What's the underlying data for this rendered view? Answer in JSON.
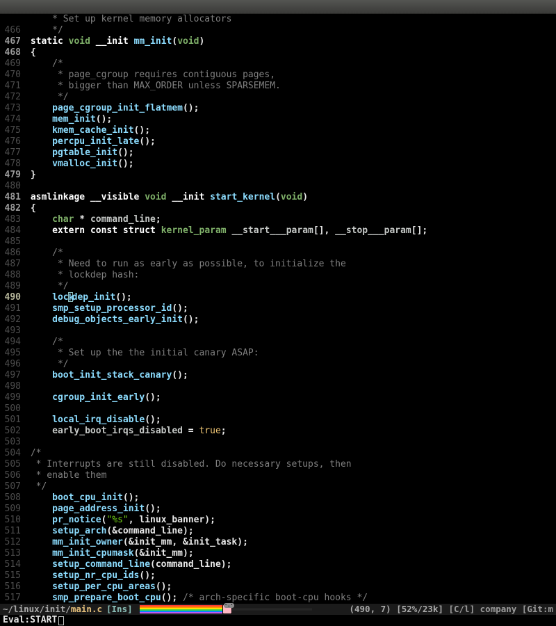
{
  "titlebar": {},
  "modeline": {
    "path_prefix": "~/linux/init/",
    "filename": "main.c",
    "mode_ins": "[Ins]",
    "position": "(490, 7)",
    "percent": "[52%/23k]",
    "modes": "[C/l] company [Git:m"
  },
  "minibuffer": {
    "prompt": "Eval: ",
    "input": "START"
  },
  "cursor": {
    "line": 490,
    "col": 7
  },
  "lines": [
    {
      "n": "   ",
      "bold": false,
      "segs": [
        [
          "    ",
          ""
        ],
        [
          " * Set up kernel memory allocators",
          "cmt"
        ]
      ]
    },
    {
      "n": 466,
      "bold": false,
      "segs": [
        [
          "    ",
          ""
        ],
        [
          " */",
          "cmt"
        ]
      ]
    },
    {
      "n": 467,
      "bold": true,
      "segs": [
        [
          " ",
          ""
        ],
        [
          "static",
          "kw"
        ],
        [
          " ",
          ""
        ],
        [
          "void",
          "typ"
        ],
        [
          " ",
          ""
        ],
        [
          "__init ",
          "kw"
        ],
        [
          "mm_init",
          "fn"
        ],
        [
          "(",
          "plain"
        ],
        [
          "void",
          "typ"
        ],
        [
          ")",
          "plain"
        ]
      ]
    },
    {
      "n": 468,
      "bold": true,
      "segs": [
        [
          " ",
          ""
        ],
        [
          "{",
          "plain"
        ]
      ]
    },
    {
      "n": 469,
      "bold": false,
      "segs": [
        [
          "     ",
          ""
        ],
        [
          "/*",
          "cmt"
        ]
      ]
    },
    {
      "n": 470,
      "bold": false,
      "segs": [
        [
          "     ",
          ""
        ],
        [
          " * page_cgroup requires contiguous pages,",
          "cmt"
        ]
      ]
    },
    {
      "n": 471,
      "bold": false,
      "segs": [
        [
          "     ",
          ""
        ],
        [
          " * bigger than MAX_ORDER unless SPARSEMEM.",
          "cmt"
        ]
      ]
    },
    {
      "n": 472,
      "bold": false,
      "segs": [
        [
          "     ",
          ""
        ],
        [
          " */",
          "cmt"
        ]
      ]
    },
    {
      "n": 473,
      "bold": false,
      "segs": [
        [
          "     ",
          ""
        ],
        [
          "page_cgroup_init_flatmem",
          "fn"
        ],
        [
          "();",
          "plain"
        ]
      ]
    },
    {
      "n": 474,
      "bold": false,
      "segs": [
        [
          "     ",
          ""
        ],
        [
          "mem_init",
          "fn"
        ],
        [
          "();",
          "plain"
        ]
      ]
    },
    {
      "n": 475,
      "bold": false,
      "segs": [
        [
          "     ",
          ""
        ],
        [
          "kmem_cache_init",
          "fn"
        ],
        [
          "();",
          "plain"
        ]
      ]
    },
    {
      "n": 476,
      "bold": false,
      "segs": [
        [
          "     ",
          ""
        ],
        [
          "percpu_init_late",
          "fn"
        ],
        [
          "();",
          "plain"
        ]
      ]
    },
    {
      "n": 477,
      "bold": false,
      "segs": [
        [
          "     ",
          ""
        ],
        [
          "pgtable_init",
          "fn"
        ],
        [
          "();",
          "plain"
        ]
      ]
    },
    {
      "n": 478,
      "bold": false,
      "segs": [
        [
          "     ",
          ""
        ],
        [
          "vmalloc_init",
          "fn"
        ],
        [
          "();",
          "plain"
        ]
      ]
    },
    {
      "n": 479,
      "bold": true,
      "segs": [
        [
          " ",
          ""
        ],
        [
          "}",
          "plain"
        ]
      ]
    },
    {
      "n": 480,
      "bold": false,
      "segs": [
        [
          "",
          ""
        ]
      ]
    },
    {
      "n": 481,
      "bold": true,
      "segs": [
        [
          " ",
          ""
        ],
        [
          "asmlinkage ",
          "kw"
        ],
        [
          "__visible ",
          "kw"
        ],
        [
          "void",
          "typ"
        ],
        [
          " ",
          ""
        ],
        [
          "__init ",
          "kw"
        ],
        [
          "start_kernel",
          "fn"
        ],
        [
          "(",
          "plain"
        ],
        [
          "void",
          "typ"
        ],
        [
          ")",
          "plain"
        ]
      ]
    },
    {
      "n": 482,
      "bold": true,
      "segs": [
        [
          " ",
          ""
        ],
        [
          "{",
          "plain"
        ]
      ]
    },
    {
      "n": 483,
      "bold": false,
      "segs": [
        [
          "     ",
          ""
        ],
        [
          "char",
          "typ"
        ],
        [
          " * ",
          "plain"
        ],
        [
          "command_line",
          "id"
        ],
        [
          ";",
          "plain"
        ]
      ]
    },
    {
      "n": 484,
      "bold": false,
      "segs": [
        [
          "     ",
          ""
        ],
        [
          "extern",
          "kw"
        ],
        [
          " ",
          ""
        ],
        [
          "const",
          "kw"
        ],
        [
          " ",
          ""
        ],
        [
          "struct",
          "kw"
        ],
        [
          " ",
          ""
        ],
        [
          "kernel_param",
          "typ"
        ],
        [
          " ",
          ""
        ],
        [
          "__start___param",
          "id"
        ],
        [
          "[], ",
          "plain"
        ],
        [
          "__stop___param",
          "id"
        ],
        [
          "[];",
          "plain"
        ]
      ]
    },
    {
      "n": 485,
      "bold": false,
      "segs": [
        [
          "",
          ""
        ]
      ]
    },
    {
      "n": 486,
      "bold": false,
      "segs": [
        [
          "     ",
          ""
        ],
        [
          "/*",
          "cmt"
        ]
      ]
    },
    {
      "n": 487,
      "bold": false,
      "segs": [
        [
          "     ",
          ""
        ],
        [
          " * Need to run as early as possible, to initialize the",
          "cmt"
        ]
      ]
    },
    {
      "n": 488,
      "bold": false,
      "segs": [
        [
          "     ",
          ""
        ],
        [
          " * lockdep hash:",
          "cmt"
        ]
      ]
    },
    {
      "n": 489,
      "bold": false,
      "segs": [
        [
          "     ",
          ""
        ],
        [
          " */",
          "cmt"
        ]
      ]
    },
    {
      "n": 490,
      "bold": false,
      "cursor": true,
      "segs": [
        [
          "     ",
          ""
        ],
        [
          "loc",
          "fn"
        ],
        [
          "CURSOR",
          ""
        ],
        [
          "dep_init",
          "fn"
        ],
        [
          "();",
          "plain"
        ]
      ]
    },
    {
      "n": 491,
      "bold": false,
      "segs": [
        [
          "     ",
          ""
        ],
        [
          "smp_setup_processor_id",
          "fn"
        ],
        [
          "();",
          "plain"
        ]
      ]
    },
    {
      "n": 492,
      "bold": false,
      "segs": [
        [
          "     ",
          ""
        ],
        [
          "debug_objects_early_init",
          "fn"
        ],
        [
          "();",
          "plain"
        ]
      ]
    },
    {
      "n": 493,
      "bold": false,
      "segs": [
        [
          "",
          ""
        ]
      ]
    },
    {
      "n": 494,
      "bold": false,
      "segs": [
        [
          "     ",
          ""
        ],
        [
          "/*",
          "cmt"
        ]
      ]
    },
    {
      "n": 495,
      "bold": false,
      "segs": [
        [
          "     ",
          ""
        ],
        [
          " * Set up the the initial canary ASAP:",
          "cmt"
        ]
      ]
    },
    {
      "n": 496,
      "bold": false,
      "segs": [
        [
          "     ",
          ""
        ],
        [
          " */",
          "cmt"
        ]
      ]
    },
    {
      "n": 497,
      "bold": false,
      "segs": [
        [
          "     ",
          ""
        ],
        [
          "boot_init_stack_canary",
          "fn"
        ],
        [
          "();",
          "plain"
        ]
      ]
    },
    {
      "n": 498,
      "bold": false,
      "segs": [
        [
          "",
          ""
        ]
      ]
    },
    {
      "n": 499,
      "bold": false,
      "segs": [
        [
          "     ",
          ""
        ],
        [
          "cgroup_init_early",
          "fn"
        ],
        [
          "();",
          "plain"
        ]
      ]
    },
    {
      "n": 500,
      "bold": false,
      "segs": [
        [
          "",
          ""
        ]
      ]
    },
    {
      "n": 501,
      "bold": false,
      "segs": [
        [
          "     ",
          ""
        ],
        [
          "local_irq_disable",
          "fn"
        ],
        [
          "();",
          "plain"
        ]
      ]
    },
    {
      "n": 502,
      "bold": false,
      "segs": [
        [
          "     ",
          ""
        ],
        [
          "early_boot_irqs_disabled",
          "id"
        ],
        [
          " = ",
          "plain"
        ],
        [
          "true",
          "cst"
        ],
        [
          ";",
          "plain"
        ]
      ]
    },
    {
      "n": 503,
      "bold": false,
      "segs": [
        [
          "",
          ""
        ]
      ]
    },
    {
      "n": 504,
      "bold": false,
      "segs": [
        [
          " ",
          ""
        ],
        [
          "/*",
          "cmt"
        ]
      ]
    },
    {
      "n": 505,
      "bold": false,
      "segs": [
        [
          " ",
          ""
        ],
        [
          " * Interrupts are still disabled. Do necessary setups, then",
          "cmt"
        ]
      ]
    },
    {
      "n": 506,
      "bold": false,
      "segs": [
        [
          " ",
          ""
        ],
        [
          " * enable them",
          "cmt"
        ]
      ]
    },
    {
      "n": 507,
      "bold": false,
      "segs": [
        [
          " ",
          ""
        ],
        [
          " */",
          "cmt"
        ]
      ]
    },
    {
      "n": 508,
      "bold": false,
      "segs": [
        [
          "     ",
          ""
        ],
        [
          "boot_cpu_init",
          "fn"
        ],
        [
          "();",
          "plain"
        ]
      ]
    },
    {
      "n": 509,
      "bold": false,
      "segs": [
        [
          "     ",
          ""
        ],
        [
          "page_address_init",
          "fn"
        ],
        [
          "();",
          "plain"
        ]
      ]
    },
    {
      "n": 510,
      "bold": false,
      "segs": [
        [
          "     ",
          ""
        ],
        [
          "pr_notice",
          "fn"
        ],
        [
          "(",
          "plain"
        ],
        [
          "\"%s\"",
          "str"
        ],
        [
          ", linux_banner);",
          "plain"
        ]
      ]
    },
    {
      "n": 511,
      "bold": false,
      "segs": [
        [
          "     ",
          ""
        ],
        [
          "setup_arch",
          "fn"
        ],
        [
          "(&command_line);",
          "plain"
        ]
      ]
    },
    {
      "n": 512,
      "bold": false,
      "segs": [
        [
          "     ",
          ""
        ],
        [
          "mm_init_owner",
          "fn"
        ],
        [
          "(&init_mm, &init_task);",
          "plain"
        ]
      ]
    },
    {
      "n": 513,
      "bold": false,
      "segs": [
        [
          "     ",
          ""
        ],
        [
          "mm_init_cpumask",
          "fn"
        ],
        [
          "(&init_mm);",
          "plain"
        ]
      ]
    },
    {
      "n": 514,
      "bold": false,
      "segs": [
        [
          "     ",
          ""
        ],
        [
          "setup_command_line",
          "fn"
        ],
        [
          "(command_line);",
          "plain"
        ]
      ]
    },
    {
      "n": 515,
      "bold": false,
      "segs": [
        [
          "     ",
          ""
        ],
        [
          "setup_nr_cpu_ids",
          "fn"
        ],
        [
          "();",
          "plain"
        ]
      ]
    },
    {
      "n": 516,
      "bold": false,
      "segs": [
        [
          "     ",
          ""
        ],
        [
          "setup_per_cpu_areas",
          "fn"
        ],
        [
          "();",
          "plain"
        ]
      ]
    },
    {
      "n": 517,
      "bold": false,
      "segs": [
        [
          "     ",
          ""
        ],
        [
          "smp_prepare_boot_cpu",
          "fn"
        ],
        [
          "(); ",
          "plain"
        ],
        [
          "/* arch-specific boot-cpu hooks */",
          "cmt"
        ]
      ]
    }
  ]
}
